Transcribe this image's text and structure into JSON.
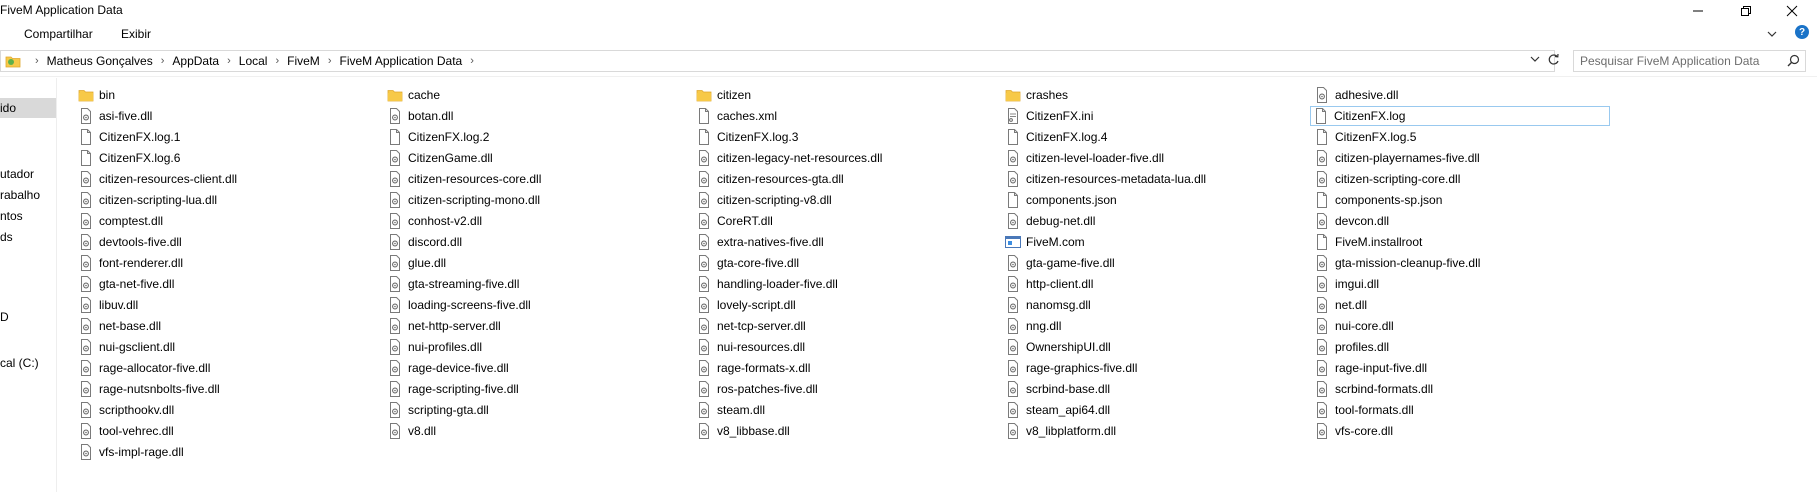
{
  "window": {
    "title": "FiveM Application Data"
  },
  "ribbon": {
    "tabs": [
      "Compartilhar",
      "Exibir"
    ]
  },
  "address": {
    "crumbs": [
      "Matheus Gonçalves",
      "AppData",
      "Local",
      "FiveM",
      "FiveM Application Data"
    ]
  },
  "search": {
    "placeholder": "Pesquisar FiveM Application Data"
  },
  "nav": {
    "items": [
      "ido",
      "utador",
      "rabalho",
      "ntos",
      "ds",
      "D",
      "cal (C:)"
    ],
    "selected_index": 0
  },
  "files": {
    "selected": "CitizenFX.log",
    "columns": [
      [
        {
          "name": "bin",
          "type": "folder"
        },
        {
          "name": "asi-five.dll",
          "type": "dll"
        },
        {
          "name": "CitizenFX.log.1",
          "type": "file"
        },
        {
          "name": "CitizenFX.log.6",
          "type": "file"
        },
        {
          "name": "citizen-resources-client.dll",
          "type": "dll"
        },
        {
          "name": "citizen-scripting-lua.dll",
          "type": "dll"
        },
        {
          "name": "comptest.dll",
          "type": "dll"
        },
        {
          "name": "devtools-five.dll",
          "type": "dll"
        },
        {
          "name": "font-renderer.dll",
          "type": "dll"
        },
        {
          "name": "gta-net-five.dll",
          "type": "dll"
        },
        {
          "name": "libuv.dll",
          "type": "dll"
        },
        {
          "name": "net-base.dll",
          "type": "dll"
        },
        {
          "name": "nui-gsclient.dll",
          "type": "dll"
        },
        {
          "name": "rage-allocator-five.dll",
          "type": "dll"
        },
        {
          "name": "rage-nutsnbolts-five.dll",
          "type": "dll"
        },
        {
          "name": "scripthookv.dll",
          "type": "dll"
        },
        {
          "name": "tool-vehrec.dll",
          "type": "dll"
        },
        {
          "name": "vfs-impl-rage.dll",
          "type": "dll"
        }
      ],
      [
        {
          "name": "cache",
          "type": "folder"
        },
        {
          "name": "botan.dll",
          "type": "dll"
        },
        {
          "name": "CitizenFX.log.2",
          "type": "file"
        },
        {
          "name": "CitizenGame.dll",
          "type": "dll"
        },
        {
          "name": "citizen-resources-core.dll",
          "type": "dll"
        },
        {
          "name": "citizen-scripting-mono.dll",
          "type": "dll"
        },
        {
          "name": "conhost-v2.dll",
          "type": "dll"
        },
        {
          "name": "discord.dll",
          "type": "dll"
        },
        {
          "name": "glue.dll",
          "type": "dll"
        },
        {
          "name": "gta-streaming-five.dll",
          "type": "dll"
        },
        {
          "name": "loading-screens-five.dll",
          "type": "dll"
        },
        {
          "name": "net-http-server.dll",
          "type": "dll"
        },
        {
          "name": "nui-profiles.dll",
          "type": "dll"
        },
        {
          "name": "rage-device-five.dll",
          "type": "dll"
        },
        {
          "name": "rage-scripting-five.dll",
          "type": "dll"
        },
        {
          "name": "scripting-gta.dll",
          "type": "dll"
        },
        {
          "name": "v8.dll",
          "type": "dll"
        }
      ],
      [
        {
          "name": "citizen",
          "type": "folder"
        },
        {
          "name": "caches.xml",
          "type": "file"
        },
        {
          "name": "CitizenFX.log.3",
          "type": "file"
        },
        {
          "name": "citizen-legacy-net-resources.dll",
          "type": "dll"
        },
        {
          "name": "citizen-resources-gta.dll",
          "type": "dll"
        },
        {
          "name": "citizen-scripting-v8.dll",
          "type": "dll"
        },
        {
          "name": "CoreRT.dll",
          "type": "dll"
        },
        {
          "name": "extra-natives-five.dll",
          "type": "dll"
        },
        {
          "name": "gta-core-five.dll",
          "type": "dll"
        },
        {
          "name": "handling-loader-five.dll",
          "type": "dll"
        },
        {
          "name": "lovely-script.dll",
          "type": "dll"
        },
        {
          "name": "net-tcp-server.dll",
          "type": "dll"
        },
        {
          "name": "nui-resources.dll",
          "type": "dll"
        },
        {
          "name": "rage-formats-x.dll",
          "type": "dll"
        },
        {
          "name": "ros-patches-five.dll",
          "type": "dll"
        },
        {
          "name": "steam.dll",
          "type": "dll"
        },
        {
          "name": "v8_libbase.dll",
          "type": "dll"
        }
      ],
      [
        {
          "name": "crashes",
          "type": "folder"
        },
        {
          "name": "CitizenFX.ini",
          "type": "ini"
        },
        {
          "name": "CitizenFX.log.4",
          "type": "file"
        },
        {
          "name": "citizen-level-loader-five.dll",
          "type": "dll"
        },
        {
          "name": "citizen-resources-metadata-lua.dll",
          "type": "dll"
        },
        {
          "name": "components.json",
          "type": "file"
        },
        {
          "name": "debug-net.dll",
          "type": "dll"
        },
        {
          "name": "FiveM.com",
          "type": "app"
        },
        {
          "name": "gta-game-five.dll",
          "type": "dll"
        },
        {
          "name": "http-client.dll",
          "type": "dll"
        },
        {
          "name": "nanomsg.dll",
          "type": "dll"
        },
        {
          "name": "nng.dll",
          "type": "dll"
        },
        {
          "name": "OwnershipUI.dll",
          "type": "dll"
        },
        {
          "name": "rage-graphics-five.dll",
          "type": "dll"
        },
        {
          "name": "scrbind-base.dll",
          "type": "dll"
        },
        {
          "name": "steam_api64.dll",
          "type": "dll"
        },
        {
          "name": "v8_libplatform.dll",
          "type": "dll"
        }
      ],
      [
        {
          "name": "adhesive.dll",
          "type": "dll"
        },
        {
          "name": "CitizenFX.log",
          "type": "file"
        },
        {
          "name": "CitizenFX.log.5",
          "type": "file"
        },
        {
          "name": "citizen-playernames-five.dll",
          "type": "dll"
        },
        {
          "name": "citizen-scripting-core.dll",
          "type": "dll"
        },
        {
          "name": "components-sp.json",
          "type": "file"
        },
        {
          "name": "devcon.dll",
          "type": "dll"
        },
        {
          "name": "FiveM.installroot",
          "type": "file"
        },
        {
          "name": "gta-mission-cleanup-five.dll",
          "type": "dll"
        },
        {
          "name": "imgui.dll",
          "type": "dll"
        },
        {
          "name": "net.dll",
          "type": "dll"
        },
        {
          "name": "nui-core.dll",
          "type": "dll"
        },
        {
          "name": "profiles.dll",
          "type": "dll"
        },
        {
          "name": "rage-input-five.dll",
          "type": "dll"
        },
        {
          "name": "scrbind-formats.dll",
          "type": "dll"
        },
        {
          "name": "tool-formats.dll",
          "type": "dll"
        },
        {
          "name": "vfs-core.dll",
          "type": "dll"
        }
      ]
    ]
  },
  "colors": {
    "folder": "#f7c948",
    "folder_dark": "#e0a82e",
    "selection_border": "#99c9ef",
    "nav_selected": "#d9d9d9",
    "accent": "#1a73c8"
  },
  "icons": {
    "minimize": "minimize-icon",
    "maximize": "restore-icon",
    "close": "close-icon",
    "refresh": "refresh-icon",
    "dropdown": "chevron-down-icon",
    "search": "search-icon",
    "location": "folder-location-icon"
  }
}
